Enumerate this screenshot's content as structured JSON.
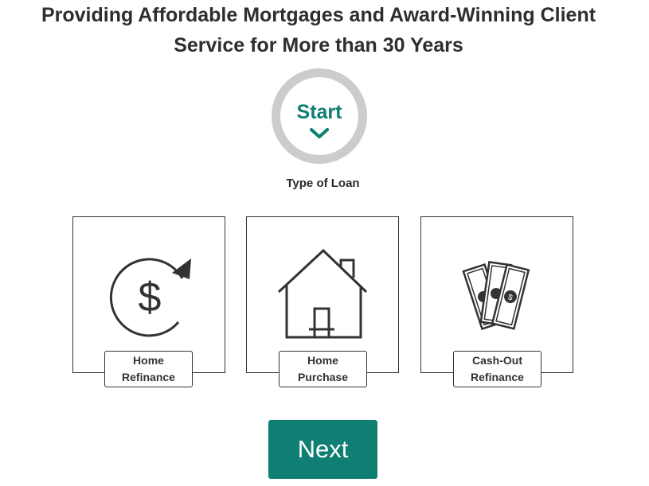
{
  "header": {
    "line1": "Providing Affordable Mortgages and Award-Winning Client",
    "line2": "Service for More than 30 Years"
  },
  "progress": {
    "label": "Start",
    "icon": "chevron-down-icon"
  },
  "step": {
    "title": "Type of Loan"
  },
  "options": [
    {
      "line1": "Home",
      "line2": "Refinance",
      "icon": "dollar-refresh-icon"
    },
    {
      "line1": "Home",
      "line2": "Purchase",
      "icon": "house-icon"
    },
    {
      "line1": "Cash-Out",
      "line2": "Refinance",
      "icon": "cash-bills-icon"
    }
  ],
  "actions": {
    "next_label": "Next"
  },
  "colors": {
    "accent": "#0e7f72",
    "ring": "#cccccc",
    "text": "#2b2b2b"
  }
}
